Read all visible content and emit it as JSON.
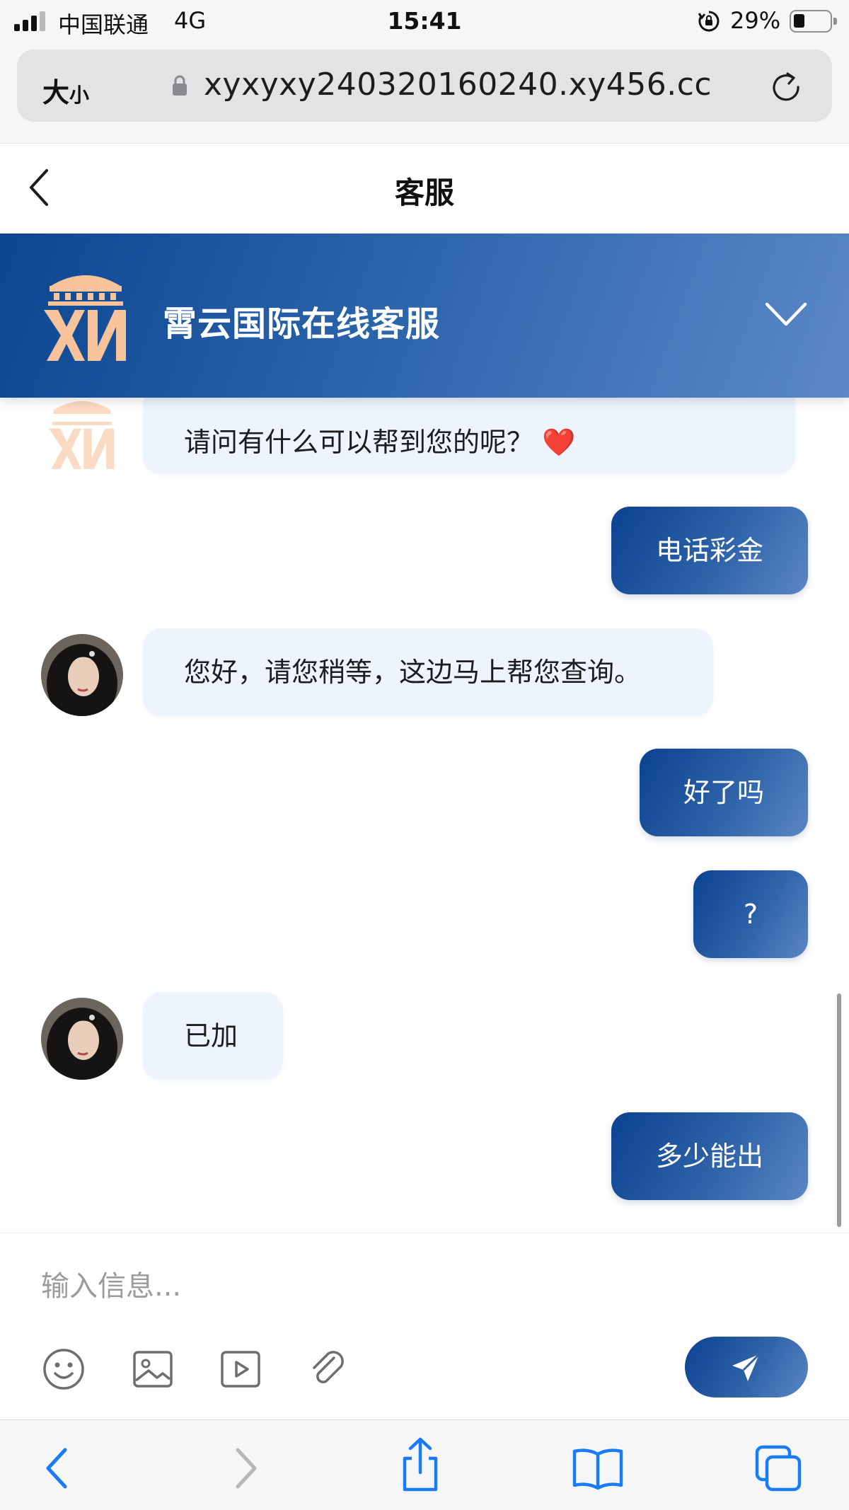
{
  "status_bar": {
    "carrier": "中国联通",
    "network": "4G",
    "time": "15:41",
    "battery_percent_text": "29%",
    "battery_level": 0.29,
    "signal_bars_active": 3
  },
  "address_bar": {
    "text_size_label_big": "大",
    "text_size_label_small": "小",
    "url": "xyxyxy240320160240.xy456.cc"
  },
  "page": {
    "title": "客服"
  },
  "banner": {
    "title": "霄云国际在线客服",
    "accent_color": "#2f67ae"
  },
  "messages": [
    {
      "side": "in",
      "avatar": "logo",
      "text": "请问有什么可以帮到您的呢？ ❤️"
    },
    {
      "side": "out",
      "text": "电话彩金"
    },
    {
      "side": "in",
      "avatar": "photo",
      "text": "您好，请您稍等，这边马上帮您查询。"
    },
    {
      "side": "out",
      "text": "好了吗"
    },
    {
      "side": "out",
      "text": "?"
    },
    {
      "side": "in",
      "avatar": "photo",
      "text": "已加"
    },
    {
      "side": "out",
      "text": "多少能出"
    }
  ],
  "composer": {
    "placeholder": "输入信息...",
    "value": "",
    "tools": [
      "emoji-icon",
      "image-icon",
      "video-icon",
      "attachment-icon"
    ],
    "send_icon": "send-icon"
  },
  "toolbar": {
    "items": [
      "back-arrow-icon",
      "forward-arrow-icon",
      "share-icon",
      "bookmarks-icon",
      "tabs-icon"
    ]
  },
  "colors": {
    "brand_blue_dark": "#0b4290",
    "brand_blue_light": "#5a86c4",
    "incoming_bubble": "#eef4fd",
    "logo_orange": "#f7c39a",
    "safari_blue": "#1a7cf5"
  }
}
